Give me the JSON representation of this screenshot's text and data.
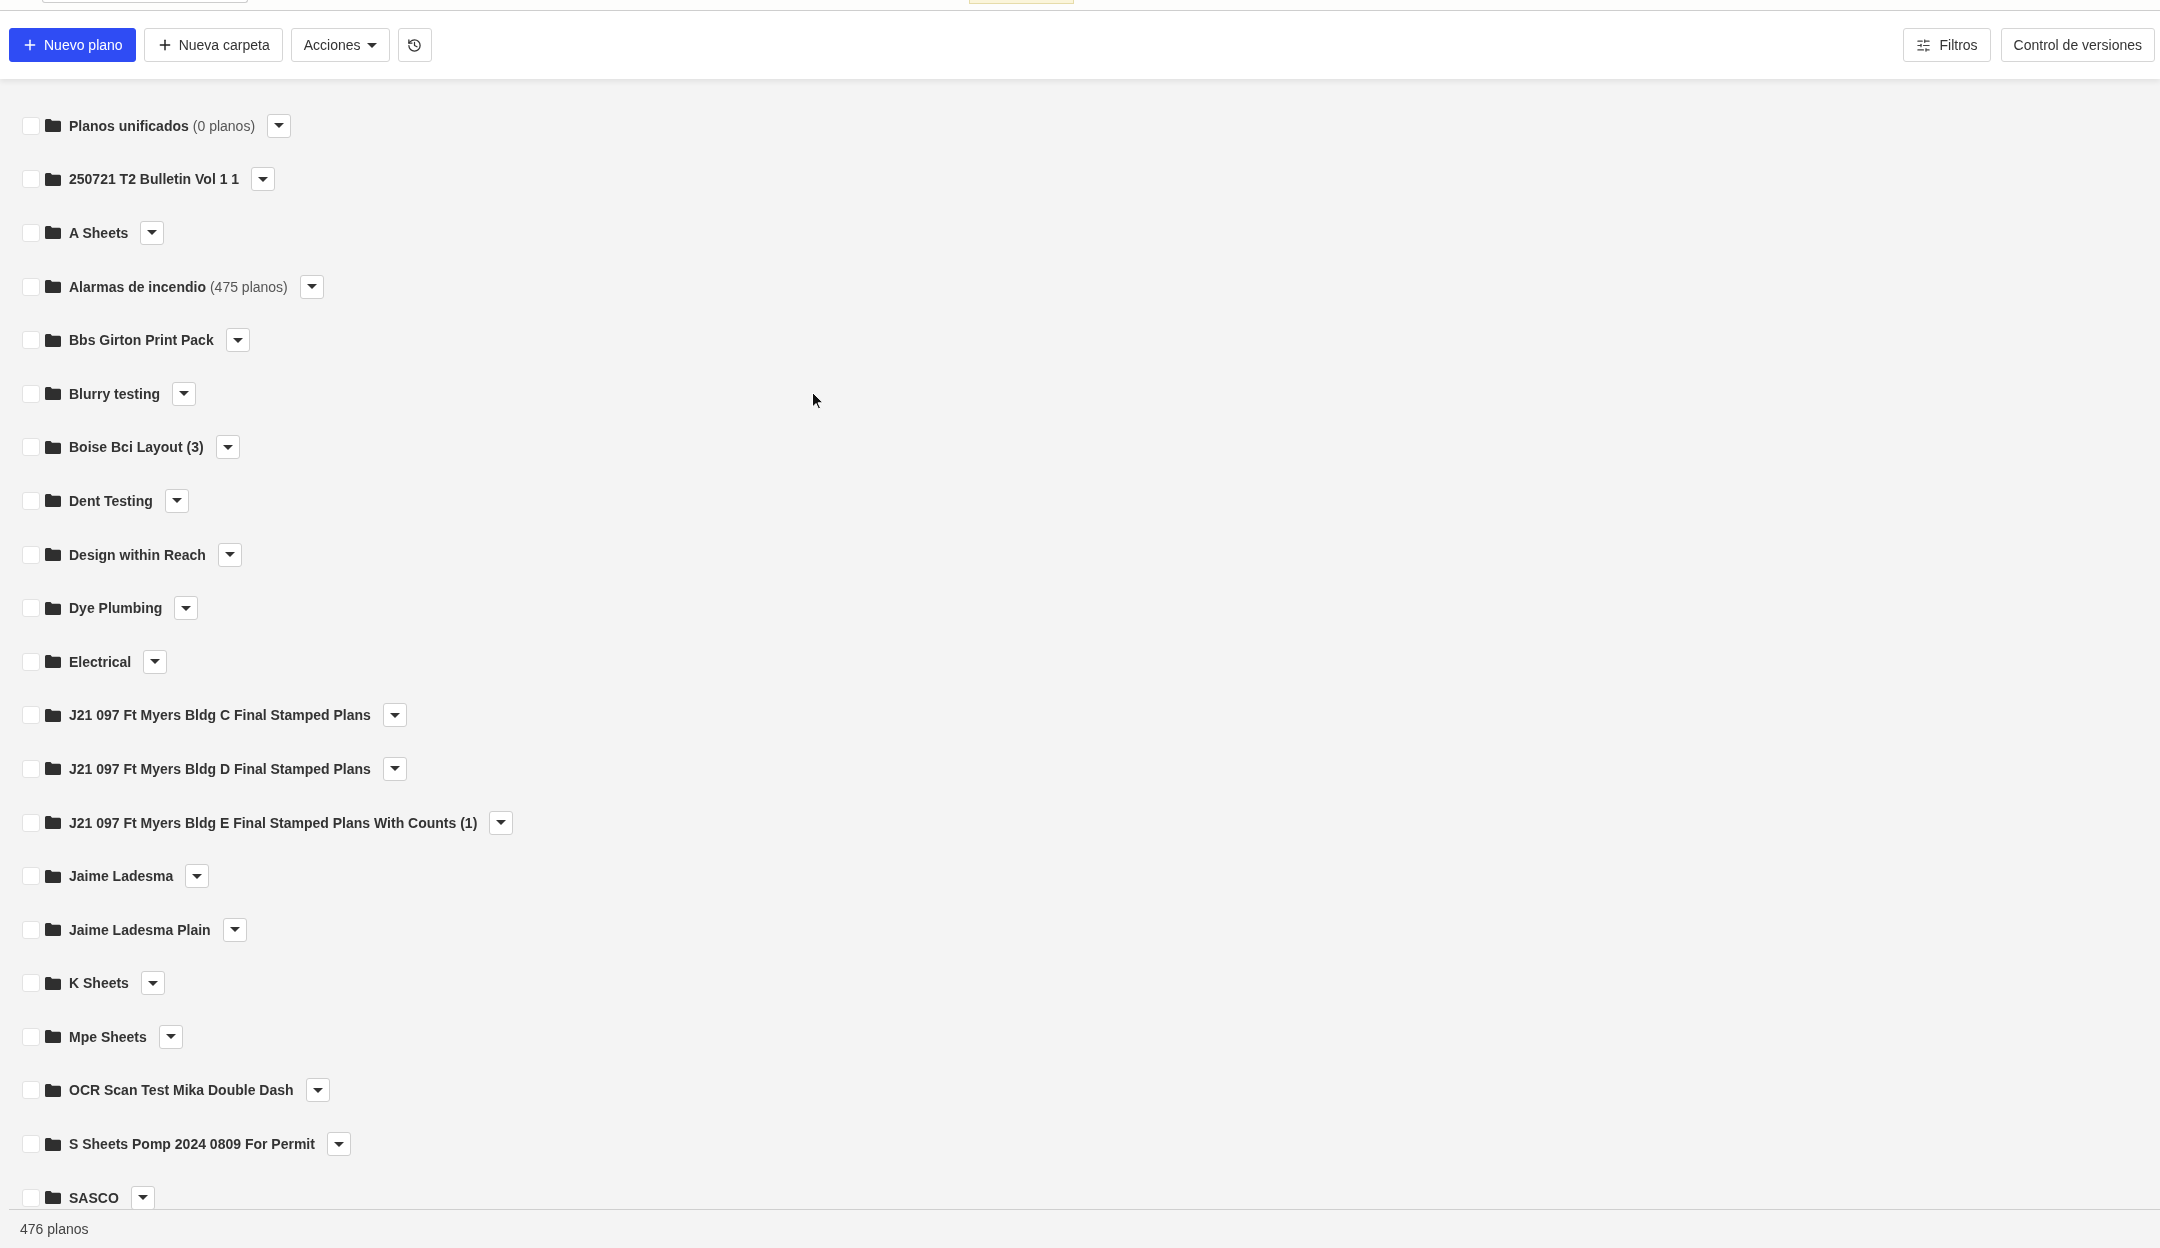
{
  "toolbar": {
    "actions": [
      {
        "kind": "create",
        "label": "Nuevo plano"
      },
      {
        "kind": "add",
        "label": "Nueva carpeta"
      },
      {
        "kind": "menu",
        "label": "Acciones"
      },
      {
        "kind": "history"
      }
    ],
    "tools": [
      {
        "kind": "filter",
        "label": "Filtros"
      },
      {
        "kind": "plain",
        "label": "Control de versiones"
      }
    ]
  },
  "folders": [
    {
      "name": "Planos unificados",
      "count": "(0 planos)",
      "checked": false
    },
    {
      "name": "250721 T2 Bulletin Vol 1 1",
      "checked": false
    },
    {
      "name": "A Sheets",
      "checked": false
    },
    {
      "name": "Alarmas de incendio",
      "count": "(475 planos)",
      "checked": false
    },
    {
      "name": "Bbs Girton Print Pack",
      "checked": false
    },
    {
      "name": "Blurry testing",
      "checked": false
    },
    {
      "name": "Boise Bci Layout (3)",
      "checked": false
    },
    {
      "name": "Dent Testing",
      "checked": false
    },
    {
      "name": "Design within Reach",
      "checked": false
    },
    {
      "name": "Dye Plumbing",
      "checked": false
    },
    {
      "name": "Electrical",
      "checked": false
    },
    {
      "name": "J21 097 Ft Myers Bldg C Final Stamped Plans",
      "checked": false
    },
    {
      "name": "J21 097 Ft Myers Bldg D Final Stamped Plans",
      "checked": false
    },
    {
      "name": "J21 097 Ft Myers Bldg E Final Stamped Plans With Counts (1)",
      "checked": false
    },
    {
      "name": "Jaime Ladesma",
      "checked": false
    },
    {
      "name": "Jaime Ladesma Plain",
      "checked": false
    },
    {
      "name": "K Sheets",
      "checked": false
    },
    {
      "name": "Mpe Sheets",
      "checked": false
    },
    {
      "name": "OCR Scan Test Mika Double Dash",
      "checked": false
    },
    {
      "name": "S Sheets Pomp 2024 0809 For Permit",
      "checked": false
    },
    {
      "name": "SASCO",
      "checked": false
    }
  ],
  "footer": {
    "total": "476 planos"
  }
}
